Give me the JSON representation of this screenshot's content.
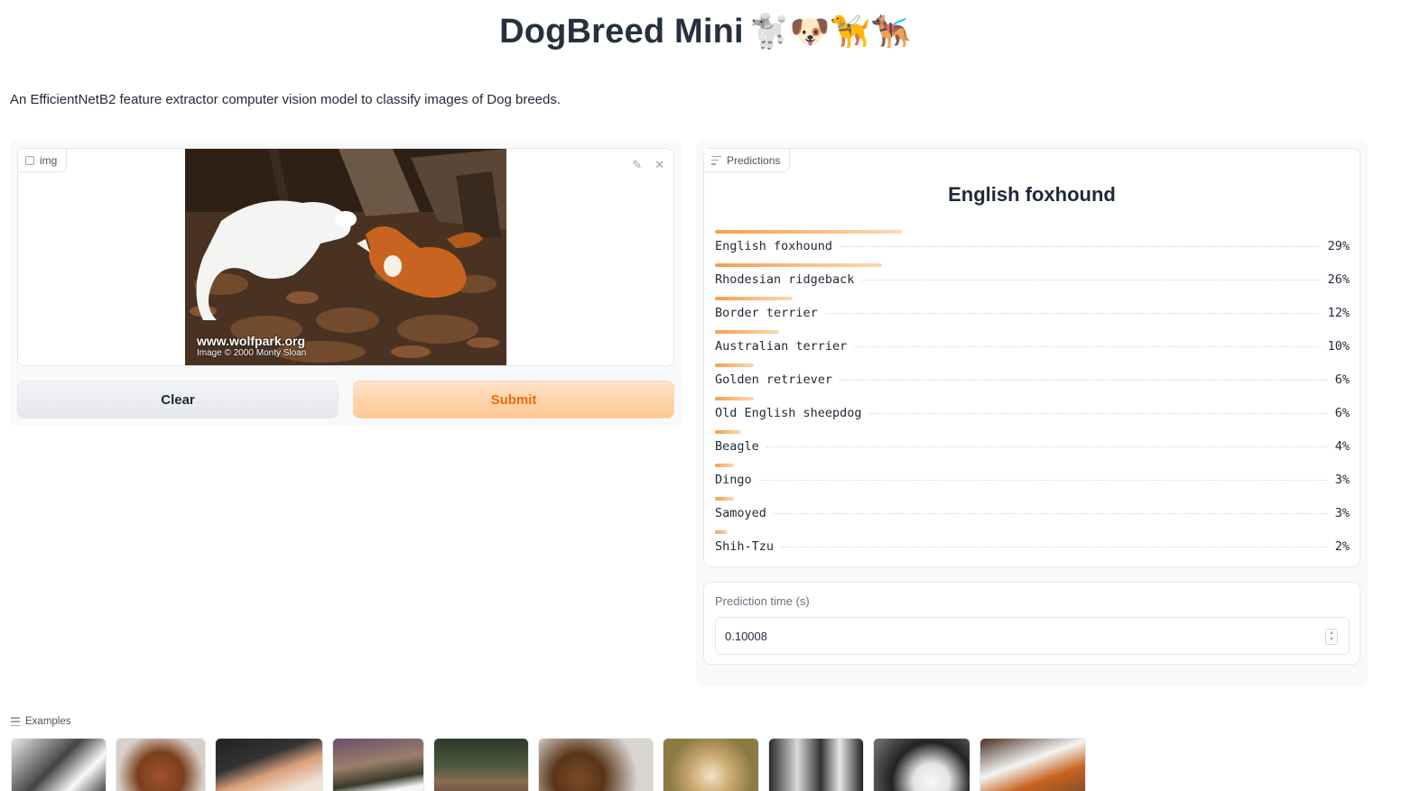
{
  "header": {
    "title": "DogBreed Mini",
    "emoji": "🐩🐶🦮🐕‍🦺",
    "description": "An EfficientNetB2 feature extractor computer vision model to classify images of Dog breeds."
  },
  "input_panel": {
    "label": "img",
    "photo_caption_line1": "www.wolfpark.org",
    "photo_caption_line2": "Image © 2000 Monty Sloan",
    "clear_label": "Clear",
    "submit_label": "Submit"
  },
  "predictions": {
    "label": "Predictions",
    "top_label": "English foxhound",
    "items": [
      {
        "label": "English foxhound",
        "pct": "29%",
        "value": 0.29
      },
      {
        "label": "Rhodesian ridgeback",
        "pct": "26%",
        "value": 0.26
      },
      {
        "label": "Border terrier",
        "pct": "12%",
        "value": 0.12
      },
      {
        "label": "Australian terrier",
        "pct": "10%",
        "value": 0.1
      },
      {
        "label": "Golden retriever",
        "pct": "6%",
        "value": 0.06
      },
      {
        "label": "Old English sheepdog",
        "pct": "6%",
        "value": 0.06
      },
      {
        "label": "Beagle",
        "pct": "4%",
        "value": 0.04
      },
      {
        "label": "Dingo",
        "pct": "3%",
        "value": 0.03
      },
      {
        "label": "Samoyed",
        "pct": "3%",
        "value": 0.03
      },
      {
        "label": "Shih-Tzu",
        "pct": "2%",
        "value": 0.02
      }
    ]
  },
  "prediction_time": {
    "label": "Prediction time (s)",
    "value": "0.10008"
  },
  "examples": {
    "label": "Examples"
  },
  "colors": {
    "accent": "#f59e4a",
    "submit_text": "#ea6c0a"
  }
}
